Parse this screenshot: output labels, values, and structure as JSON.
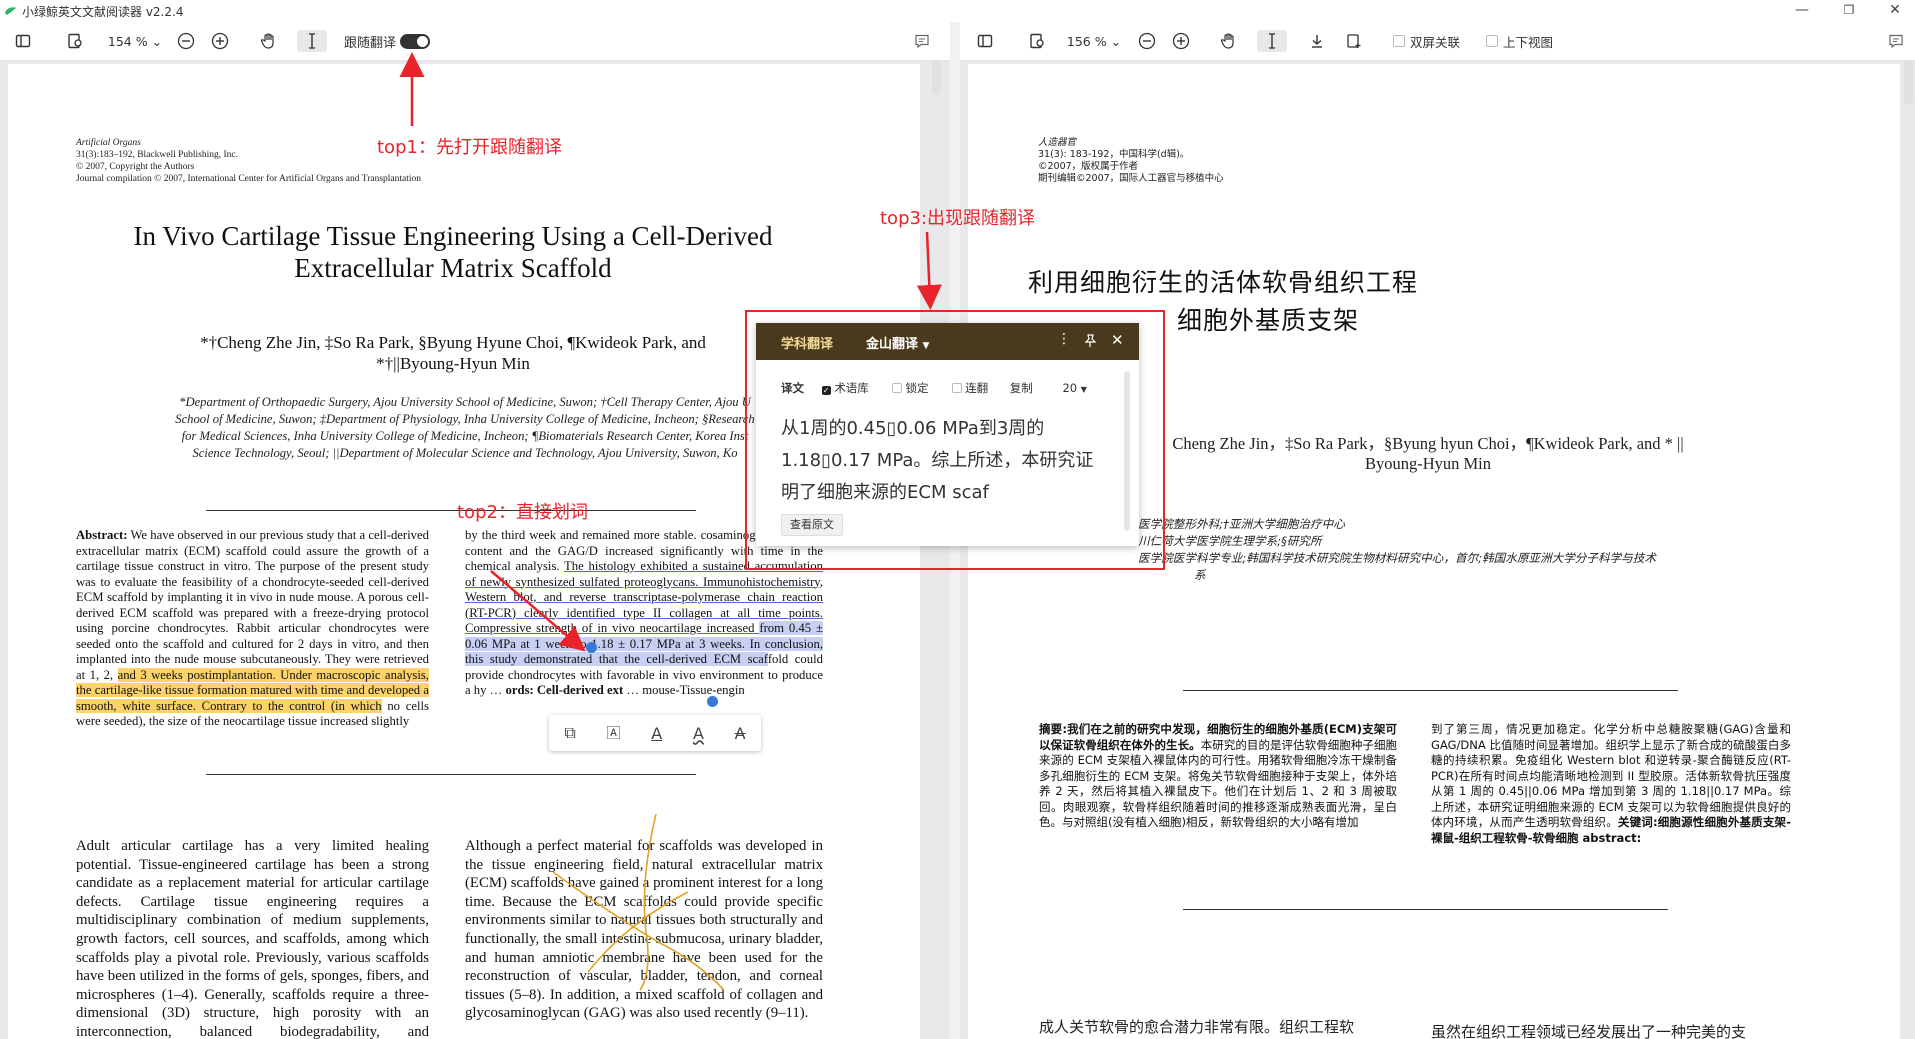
{
  "app": {
    "title": "小绿鲸英文文献阅读器 v2.2.4"
  },
  "left_toolbar": {
    "zoom": "154 %",
    "follow_translate_label": "跟随翻译"
  },
  "right_toolbar": {
    "zoom": "156 %",
    "dual_screen_label": "双屏关联",
    "vertical_view_label": "上下视图"
  },
  "annotations": {
    "top1": "top1：先打开跟随翻译",
    "top2": "top2：直接划词",
    "top3": "top3:出现跟随翻译"
  },
  "popup": {
    "tab_subject": "学科翻译",
    "tab_engine": "金山翻译",
    "label_translation": "译文",
    "opt_termbase": "术语库",
    "opt_lock": "锁定",
    "opt_continuous": "连翻",
    "opt_copy": "复制",
    "font_size": "20",
    "translation_text": "从1周的0.45▯0.06 MPa到3周的1.18▯0.17 MPa。综上所述，本研究证明了细胞来源的ECM scaf",
    "view_original": "查看原文"
  },
  "paper_en": {
    "journal": "Artificial Organs",
    "volume": "31(3):183–192, Blackwell Publishing, Inc.",
    "copyright": "© 2007, Copyright the Authors",
    "compilation": "Journal compilation © 2007, International Center for Artificial Organs and Transplantation",
    "title_line1": "In Vivo Cartilage Tissue Engineering Using a Cell-Derived",
    "title_line2": "Extracellular Matrix Scaffold",
    "authors_line1": "*†Cheng Zhe Jin, ‡So Ra Park, §Byung Hyune Choi, ¶Kwideok Park, and",
    "authors_line2": "*†||Byoung-Hyun Min",
    "affil_line1": "*Department of Orthopaedic Surgery, Ajou University School of Medicine, Suwon; †Cell Therapy Center, Ajou U",
    "affil_line2": "School of Medicine, Suwon; ‡Department of Physiology, Inha University College of Medicine, Incheon; §Research",
    "affil_line3": "for Medical Sciences, Inha University College of Medicine, Incheon; ¶Biomaterials Research Center, Korea Inst",
    "affil_line4": "Science Technology, Seoul; ||Department of Molecular Science and Technology, Ajou University, Suwon, Ko",
    "abstract_label": "Abstract:",
    "abstract_col1_a": " We have observed in our previous study that a cell-derived extracellular matrix (ECM) scaffold could assure the growth of a cartilage tissue construct in vitro. The purpose of the present study was to evaluate the feasibility of a chondrocyte-seeded cell-derived ECM scaffold by implanting it in vivo in nude mouse. A porous cell-derived ECM scaffold was prepared with a freeze-drying protocol using porcine chondrocytes. Rabbit articular chondrocytes were seeded onto the scaffold and cultured for 2 days in vitro, and then implanted into the nude mouse subcutaneously. They were retrieved at 1, 2, ",
    "abstract_col1_hl": "and 3 weeks postimplantation. Under macroscopic analysis, the cartilage-like tissue formation matured with time and developed a smooth, white surface. Contrary to the control (in which",
    "abstract_col1_b": " no cells were seeded), the size of the neocartilage tissue increased slightly",
    "abstract_col2_a": "by the third week and remained more stable. cosaminoglycan (GAG) content and the GAG/D increased significantly with time in the chemical analysis. ",
    "abstract_col2_ul": "The histology exhibited a sustained accumulation of newly synthesized sulfated proteoglycans. Immunohistochemistry, Western blot, and reverse transcriptase-polymerase chain reaction (RT-PCR) clearly identified type II collagen at all time points. Compressive strength of in vivo neocartilage increased ",
    "abstract_col2_hl": "from 0.45 ± 0.06 MPa at 1 week to 1.18 ± 0.17 MPa at 3 weeks. In conclusion, this study demonstrated that the cell-derived ECM scaf",
    "abstract_col2_b": "fold could provide chondrocytes with favorable in vivo environment to produce a hy",
    "abstract_col2_kw": "ords: Cell-derived ext",
    "abstract_col2_c": "mouse-Tissue-engin",
    "intro_col1": "Adult articular cartilage has a very limited healing potential. Tissue-engineered cartilage has been a strong candidate as a replacement material for articular cartilage defects. Cartilage tissue engineering requires a multidisciplinary combination of medium supplements, growth factors, cell sources, and scaffolds, among which scaffolds play a pivotal role. Previously, various scaffolds have been utilized in the forms of gels, sponges, fibers, and microspheres (1–4). Generally, scaffolds require a three-dimensional (3D) structure, high porosity with an interconnection, balanced biodegradability, and biocompatibility",
    "intro_col2": "Although a perfect material for scaffolds was developed in the tissue engineering field, natural extracellular matrix (ECM) scaffolds have gained a prominent interest for a long time. Because the ECM scaffolds could provide specific environments similar to natural tissues both structurally and functionally, the small intestine submucosa, urinary bladder, and human amniotic membrane have been used for the reconstruction of vascular, bladder, tendon, and corneal tissues (5–8). In addition, a mixed scaffold of collagen and glycosaminoglycan (GAG) was also used recently (9–11)."
  },
  "paper_cn": {
    "journal": "人造器官",
    "volume": "31(3): 183-192，中国科学(d辑)。",
    "copyright": "©2007，版权属于作者",
    "compilation": "期刊编辑©2007，国际人工器官与移植中心",
    "title_line1": "利用细胞衍生的活体软骨组织工程",
    "title_line2": "细胞外基质支架",
    "authors_line1": "Cheng Zhe Jin，‡So Ra Park，§Byung hyun Choi，¶Kwideok Park, and * ||",
    "authors_line2": "Byoung-Hyun Min",
    "affil_line1": "医学院整形外科;†亚洲大学细胞治疗中心",
    "affil_line2": "川仁荷大学医学院生理学系;§研究所",
    "affil_line3": "医学院医学科学专业;韩国科学技术研究院生物材料研究中心，首尔;韩国水原亚洲大学分子科学与技术",
    "affil_line4": "系",
    "abstract_col1_bold": "摘要:我们在之前的研究中发现，细胞衍生的细胞外基质(ECM)支架可以保证软骨组织在体外的生长。",
    "abstract_col1": "本研究的目的是评估软骨细胞种子细胞来源的 ECM 支架植入裸鼠体内的可行性。用猪软骨细胞冷冻干燥制备多孔细胞衍生的 ECM 支架。将兔关节软骨细胞接种于支架上，体外培养 2 天，然后将其植入裸鼠皮下。他们在计划后 1、2 和 3 周被取回。肉眼观察，软骨样组织随着时间的推移逐渐成熟表面光滑，呈白色。与对照组(没有植入细胞)相反，新软骨组织的大小略有增加",
    "abstract_col2": "到了第三周，情况更加稳定。化学分析中总糖胺聚糖(GAG)含量和 GAG/DNA 比值随时间显著增加。组织学上显示了新合成的硫酸蛋白多糖的持续积累。免疫组化 Western blot 和逆转录-聚合酶链反应(RT-PCR)在所有时间点均能清晰地检测到 II 型胶原。活体新软骨抗压强度从第 1 周的 0.45||0.06 MPa 增加到第 3 周的 1.18||0.17 MPa。综上所述，本研究证明细胞来源的 ECM 支架可以为软骨细胞提供良好的体内环境，从而产生透明软骨组织。",
    "abstract_col2_kw": "关键词:细胞源性细胞外基质支架-裸鼠-组织工程软骨-软骨细胞 abstract:",
    "intro_col1": "成人关节软骨的愈合潜力非常有限。组织工程软",
    "intro_col2": "虽然在组织工程领域已经发展出了一种完美的支"
  }
}
